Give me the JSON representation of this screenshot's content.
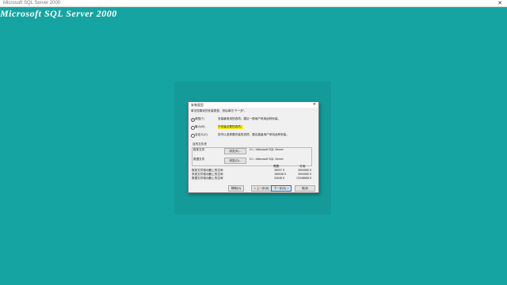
{
  "window": {
    "title": "Microsoft SQL Server 2000",
    "close_glyph": "✕"
  },
  "banner": {
    "text": "Microsoft SQL Server 2000"
  },
  "dialog": {
    "title": "安装类型",
    "close_glyph": "✕",
    "prompt": "单击您喜欢的安装类型，然后单击“下一步”。",
    "options": [
      {
        "label": "典型(T)",
        "desc": "安装最常用的选项。建议一般用户采用此种安装。",
        "selected": true
      },
      {
        "label": "最小(M)",
        "desc": "只安装必要的选项。",
        "selected": false
      },
      {
        "label": "自定义(C)",
        "desc": "您可以选择要安装的选项。建议高级用户采用此种安装。",
        "selected": false
      }
    ],
    "dest_group": "目的文件夹",
    "program_files": {
      "label": "程序文件",
      "button": "浏览(R)...",
      "path": "D:\\...\\Microsoft SQL Server"
    },
    "data_files": {
      "label": "数据文件",
      "button": "浏览(O)...",
      "path": "D:\\...\\Microsoft SQL Server"
    },
    "space": {
      "header_required": "需要:",
      "header_available": "可用:",
      "rows": [
        {
          "label": "程序文件驱动器上的空间",
          "required": "38937 K",
          "available": "3994980 K"
        },
        {
          "label": "系统文件驱动器上的空间",
          "required": "186538 K",
          "available": "3994980 K"
        },
        {
          "label": "数据文件驱动器上的空间",
          "required": "34048 K",
          "available": "12448868 K"
        }
      ]
    },
    "buttons": {
      "help": "帮助(H)",
      "back": "< 上一步(B)",
      "next": "下一步(N) >",
      "cancel": "取消"
    }
  }
}
